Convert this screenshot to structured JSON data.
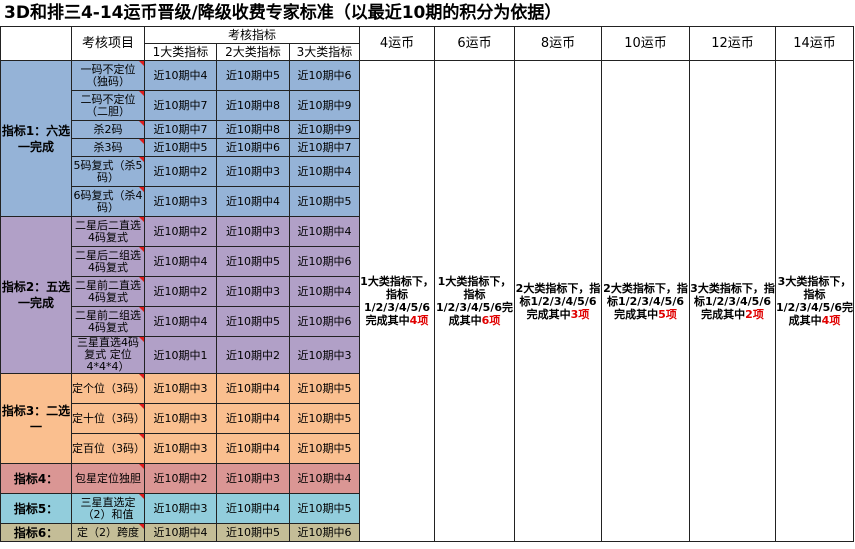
{
  "title": "3D和排三4-14运币晋级/降级收费专家标准（以最近10期的积分为依据）",
  "header": {
    "project": "考核项目",
    "indicators": "考核指标",
    "class1": "1大类指标",
    "class2": "2大类指标",
    "class3": "3大类指标",
    "coins": [
      "4运币",
      "6运币",
      "8运币",
      "10运币",
      "12运币",
      "14运币"
    ]
  },
  "groups": [
    {
      "label": "指标1：六选一完成",
      "color": "#95b3d7",
      "rows": [
        {
          "project": "一码不定位（独码）",
          "c1": "近10期中4",
          "c2": "近10期中5",
          "c3": "近10期中6"
        },
        {
          "project": "二码不定位（二胆）",
          "c1": "近10期中7",
          "c2": "近10期中8",
          "c3": "近10期中9"
        },
        {
          "project": "杀2码",
          "c1": "近10期中7",
          "c2": "近10期中8",
          "c3": "近10期中9"
        },
        {
          "project": "杀3码",
          "c1": "近10期中5",
          "c2": "近10期中6",
          "c3": "近10期中7"
        },
        {
          "project": "5码复式（杀5码）",
          "c1": "近10期中2",
          "c2": "近10期中3",
          "c3": "近10期中4"
        },
        {
          "project": "6码复式（杀4码）",
          "c1": "近10期中3",
          "c2": "近10期中4",
          "c3": "近10期中5"
        }
      ]
    },
    {
      "label": "指标2：五选一完成",
      "color": "#b1a0c7",
      "rows": [
        {
          "project": "二星后二直选4码复式",
          "c1": "近10期中2",
          "c2": "近10期中3",
          "c3": "近10期中4"
        },
        {
          "project": "二星后二组选4码复式",
          "c1": "近10期中4",
          "c2": "近10期中5",
          "c3": "近10期中6"
        },
        {
          "project": "二星前二直选4码复式",
          "c1": "近10期中2",
          "c2": "近10期中3",
          "c3": "近10期中4"
        },
        {
          "project": "二星前二组选4码复式",
          "c1": "近10期中4",
          "c2": "近10期中5",
          "c3": "近10期中6"
        },
        {
          "project": "三星直选4码复式 定位 4*4*4）",
          "c1": "近10期中1",
          "c2": "近10期中2",
          "c3": "近10期中3"
        }
      ]
    },
    {
      "label": "指标3：二选一",
      "color": "#fabf8f",
      "rows": [
        {
          "project": "定个位（3码）",
          "c1": "近10期中3",
          "c2": "近10期中4",
          "c3": "近10期中5"
        },
        {
          "project": "定十位（3码）",
          "c1": "近10期中3",
          "c2": "近10期中4",
          "c3": "近10期中5"
        },
        {
          "project": "定百位（3码）",
          "c1": "近10期中3",
          "c2": "近10期中4",
          "c3": "近10期中5"
        }
      ]
    },
    {
      "label": "指标4：",
      "color": "#da9694",
      "rows": [
        {
          "project": "包星定位独胆",
          "c1": "近10期中2",
          "c2": "近10期中3",
          "c3": "近10期中4"
        }
      ]
    },
    {
      "label": "指标5：",
      "color": "#92cddc",
      "rows": [
        {
          "project": "三星直选定（2）和值",
          "c1": "近10期中3",
          "c2": "近10期中4",
          "c3": "近10期中5"
        }
      ]
    },
    {
      "label": "指标6：",
      "color": "#c4bd97",
      "rows": [
        {
          "project": "定（2）跨度",
          "c1": "近10期中4",
          "c2": "近10期中5",
          "c3": "近10期中6"
        }
      ]
    }
  ],
  "rules": [
    {
      "pre": "1大类指标下，指标1/2/3/4/5/6完成其中",
      "num": "4项"
    },
    {
      "pre": "1大类指标下，指标1/2/3/4/5/6完成其中",
      "num": "6项"
    },
    {
      "pre": "2大类指标下，指标1/2/3/4/5/6完成其中",
      "num": "3项"
    },
    {
      "pre": "2大类指标下，指标1/2/3/4/5/6完成其中",
      "num": "5项"
    },
    {
      "pre": "3大类指标下，指标1/2/3/4/5/6完成其中",
      "num": "2项"
    },
    {
      "pre": "3大类指标下，指标1/2/3/4/5/6完成其中",
      "num": "4项"
    }
  ]
}
